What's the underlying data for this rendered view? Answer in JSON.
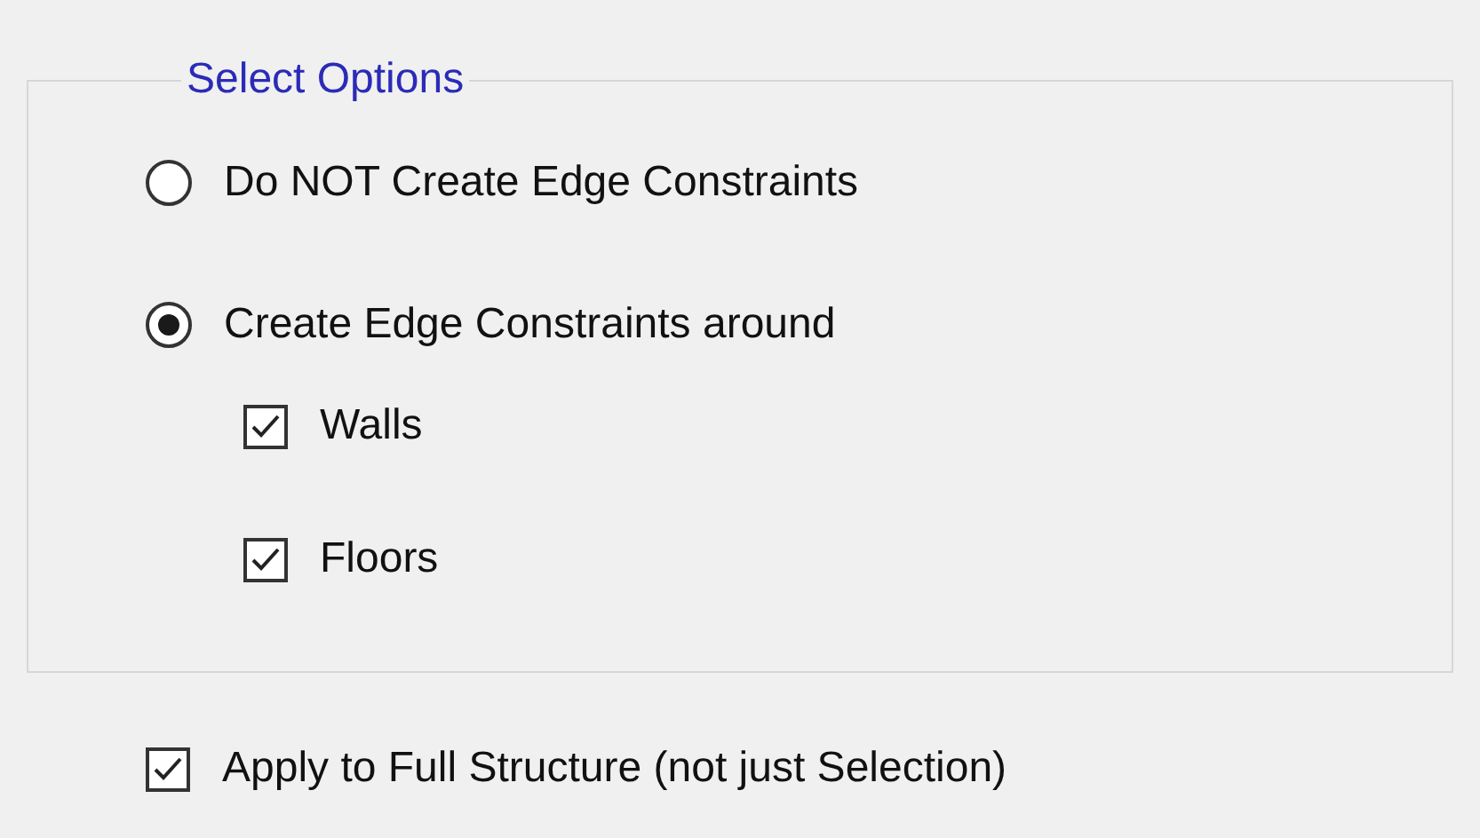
{
  "group": {
    "title": "Select Options",
    "options": [
      {
        "label": "Do NOT Create Edge Constraints",
        "selected": false
      },
      {
        "label": "Create Edge Constraints around",
        "selected": true,
        "sub_options": [
          {
            "label": "Walls",
            "checked": true
          },
          {
            "label": "Floors",
            "checked": true
          }
        ]
      }
    ]
  },
  "apply_full_structure": {
    "label": "Apply to Full Structure (not just Selection)",
    "checked": true
  }
}
